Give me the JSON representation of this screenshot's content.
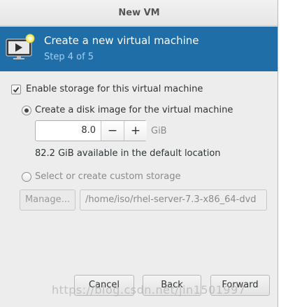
{
  "window": {
    "title": "New VM"
  },
  "banner": {
    "title": "Create a new virtual machine",
    "step": "Step 4 of 5",
    "icon": "vm-monitor-icon"
  },
  "storage": {
    "enable_label": "Enable storage for this virtual machine",
    "enable_checked": true,
    "create_disk_label": "Create a disk image for the virtual machine",
    "create_disk_selected": true,
    "size_value": "8.0",
    "size_unit": "GiB",
    "decrement_label": "−",
    "increment_label": "+",
    "available_text": "82.2 GiB available in the default location",
    "custom_label": "Select or create custom storage",
    "custom_selected": false,
    "manage_label": "Manage...",
    "custom_path": "/home/iso/rhel-server-7.3-x86_64-dvd"
  },
  "buttons": {
    "cancel": "Cancel",
    "back": "Back",
    "forward": "Forward"
  },
  "watermark": "https://blog.csdn.net/jin1501997",
  "colors": {
    "banner_bg": "#1f6ea8",
    "step_text": "#9fd0f3",
    "dialog_bg": "#ededed"
  }
}
